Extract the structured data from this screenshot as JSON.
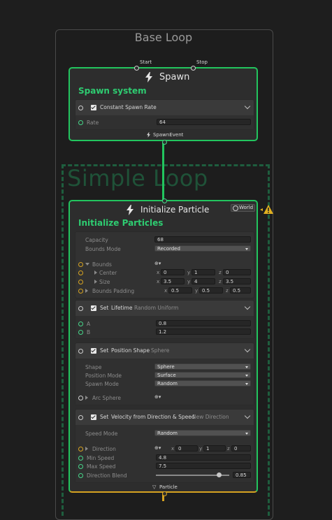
{
  "base_loop": {
    "title": "Base Loop"
  },
  "simple_loop": {
    "title": "Simple Loop"
  },
  "spawn": {
    "title": "Spawn",
    "start_label": "Start",
    "stop_label": "Stop",
    "subtitle": "Spawn system",
    "block": {
      "label": "Constant Spawn Rate",
      "rate_label": "Rate",
      "rate_value": "64"
    },
    "event_label": "SpawnEvent"
  },
  "init": {
    "title": "Initialize Particle",
    "space_label": "World",
    "subtitle": "Initialize Particles",
    "capacity_label": "Capacity",
    "capacity_value": "68",
    "bounds_mode_label": "Bounds Mode",
    "bounds_mode_value": "Recorded",
    "bounds_label": "Bounds",
    "center_label": "Center",
    "center": {
      "x": "0",
      "y": "1",
      "z": "0"
    },
    "size_label": "Size",
    "size": {
      "x": "3.5",
      "y": "4",
      "z": "3.5"
    },
    "padding_label": "Bounds Padding",
    "padding": {
      "x": "0.5",
      "y": "0.5",
      "z": "0.5"
    },
    "lifetime": {
      "set": "Set",
      "title": "Lifetime",
      "mode": "Random Uniform",
      "a_label": "A",
      "a_value": "0.8",
      "b_label": "B",
      "b_value": "1.2"
    },
    "position": {
      "set": "Set",
      "title": "Position Shape",
      "mode": "Sphere",
      "shape_label": "Shape",
      "shape_value": "Sphere",
      "pos_mode_label": "Position Mode",
      "pos_mode_value": "Surface",
      "spawn_mode_label": "Spawn Mode",
      "spawn_mode_value": "Random",
      "arc_label": "Arc Sphere"
    },
    "velocity": {
      "set": "Set",
      "title": "Velocity from Direction & Speed",
      "mode": "New Direction",
      "speed_mode_label": "Speed Mode",
      "speed_mode_value": "Random",
      "direction_label": "Direction",
      "direction": {
        "x": "0",
        "y": "1",
        "z": "0"
      },
      "min_speed_label": "Min Speed",
      "min_speed_value": "4.8",
      "max_speed_label": "Max Speed",
      "max_speed_value": "7.5",
      "blend_label": "Direction Blend",
      "blend_value": "0.85"
    },
    "output_label": "Particle"
  },
  "axis": {
    "x": "x",
    "y": "y",
    "z": "z"
  },
  "colors": {
    "green": "#22c55e",
    "orange": "#d6a321",
    "warning": "#e0b020"
  }
}
